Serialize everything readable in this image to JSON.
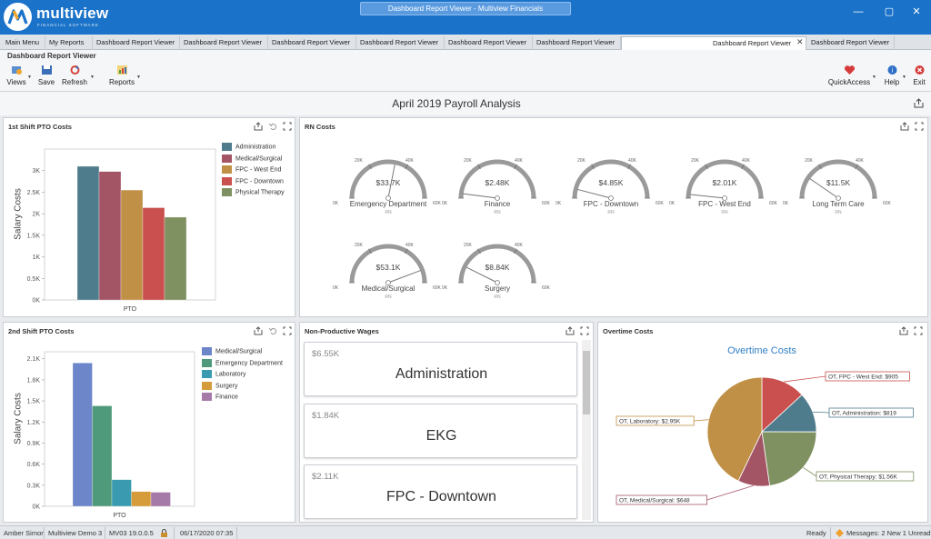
{
  "window": {
    "title": "Dashboard Report Viewer - Multiview Financials",
    "minimize": "—",
    "restore": "▢",
    "close": "✕"
  },
  "brand": {
    "name": "multiview",
    "tagline": "FINANCIAL SOFTWARE"
  },
  "tabs": [
    {
      "label": "Main Menu",
      "active": false
    },
    {
      "label": "My Reports",
      "active": false
    },
    {
      "label": "Dashboard Report Viewer",
      "active": false
    },
    {
      "label": "Dashboard Report Viewer",
      "active": false
    },
    {
      "label": "Dashboard Report Viewer",
      "active": false
    },
    {
      "label": "Dashboard Report Viewer",
      "active": false
    },
    {
      "label": "Dashboard Report Viewer",
      "active": false
    },
    {
      "label": "Dashboard Report Viewer",
      "active": false
    },
    {
      "label": "Dashboard Report Viewer",
      "active": true
    },
    {
      "label": "Dashboard Report Viewer",
      "active": false
    }
  ],
  "tab_close": "✕",
  "ribbon": {
    "title": "Dashboard Report Viewer",
    "views": "Views",
    "save": "Save",
    "refresh": "Refresh",
    "reports": "Reports",
    "quickaccess": "QuickAccess",
    "help": "Help",
    "exit": "Exit"
  },
  "dashboard_title": "April 2019 Payroll Analysis",
  "panels": {
    "shift1": {
      "title": "1st Shift PTO Costs"
    },
    "rn": {
      "title": "RN Costs"
    },
    "shift2": {
      "title": "2nd Shift PTO Costs"
    },
    "npw": {
      "title": "Non-Productive Wages"
    },
    "ot": {
      "title": "Overtime Costs"
    }
  },
  "chart_data": [
    {
      "type": "bar",
      "ylabel": "Salary Costs",
      "categories": [
        "PTO"
      ],
      "ylim": [
        0,
        3500
      ],
      "yticks": [
        "0K",
        "0.5K",
        "1K",
        "1.5K",
        "2K",
        "2.5K",
        "3K"
      ],
      "series": [
        {
          "name": "Administration",
          "value": 3100,
          "color": "#4f7c8c"
        },
        {
          "name": "Medical/Surgical",
          "value": 2980,
          "color": "#a35566"
        },
        {
          "name": "FPC - West End",
          "value": 2550,
          "color": "#c09046"
        },
        {
          "name": "FPC - Downtown",
          "value": 2140,
          "color": "#c9504e"
        },
        {
          "name": "Physical Therapy",
          "value": 1920,
          "color": "#7f9160"
        }
      ]
    },
    {
      "type": "bar",
      "ylabel": "Salary Costs",
      "categories": [
        "PTO"
      ],
      "ylim": [
        0,
        2200
      ],
      "yticks": [
        "0K",
        "0.3K",
        "0.6K",
        "0.9K",
        "1.2K",
        "1.5K",
        "1.8K",
        "2.1K"
      ],
      "series": [
        {
          "name": "Medical/Surgical",
          "value": 2040,
          "color": "#6c86c9"
        },
        {
          "name": "Emergency Department",
          "value": 1430,
          "color": "#4f9a7a"
        },
        {
          "name": "Laboratory",
          "value": 380,
          "color": "#3a9bb0"
        },
        {
          "name": "Surgery",
          "value": 210,
          "color": "#d69b3a"
        },
        {
          "name": "Finance",
          "value": 200,
          "color": "#a67aa8"
        }
      ]
    },
    {
      "type": "gauge",
      "min_label": "0K",
      "max_label": "60K",
      "ticks": [
        "20K",
        "40K"
      ],
      "range": [
        0,
        60000
      ],
      "sublabel": "RN",
      "gauges": [
        {
          "name": "Emergency Department",
          "label": "$33.7K",
          "value": 33700
        },
        {
          "name": "Finance",
          "label": "$2.48K",
          "value": 2480
        },
        {
          "name": "FPC - Downtown",
          "label": "$4.85K",
          "value": 4850
        },
        {
          "name": "FPC - West End",
          "label": "$2.01K",
          "value": 2010
        },
        {
          "name": "Long Term Care",
          "label": "$11.5K",
          "value": 11500
        },
        {
          "name": "Medical/Surgical",
          "label": "$53.1K",
          "value": 53100
        },
        {
          "name": "Surgery",
          "label": "$8.84K",
          "value": 8840
        }
      ]
    },
    {
      "type": "pie",
      "title": "Overtime Costs",
      "slices": [
        {
          "label": "OT, FPC - West End: $905",
          "value": 905,
          "color": "#c9504e"
        },
        {
          "label": "OT, Administration: $819",
          "value": 819,
          "color": "#4f7c8c"
        },
        {
          "label": "OT, Physical Therapy: $1.56K",
          "value": 1560,
          "color": "#7f9160"
        },
        {
          "label": "OT, Medical/Surgical: $648",
          "value": 648,
          "color": "#a35566"
        },
        {
          "label": "OT, Laboratory: $2.95K",
          "value": 2950,
          "color": "#c09046"
        }
      ]
    }
  ],
  "npw_cards": [
    {
      "value": "$6.55K",
      "name": "Administration"
    },
    {
      "value": "$1.84K",
      "name": "EKG"
    },
    {
      "value": "$2.11K",
      "name": "FPC - Downtown"
    }
  ],
  "status": {
    "user": "Amber Simon",
    "company": "Multiview Demo 3",
    "version": "MV03 19.0.0.5",
    "datetime": "06/17/2020 07:35",
    "ready": "Ready",
    "messages": "Messages: 2 New 1 Unread"
  }
}
